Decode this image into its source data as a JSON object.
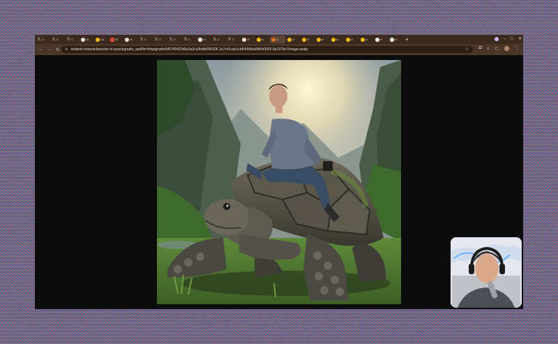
{
  "browser": {
    "tabs": [
      {
        "icon": "x-logo-icon",
        "label": "X"
      },
      {
        "icon": "x-logo-icon",
        "label": "X"
      },
      {
        "icon": "x-logo-icon",
        "label": "X"
      },
      {
        "icon": "github-icon",
        "label": "Gi"
      },
      {
        "icon": "huggingface-icon",
        "label": "Ga"
      },
      {
        "icon": "document-icon",
        "label": "Mi"
      },
      {
        "icon": "github-icon",
        "label": "Gi"
      },
      {
        "icon": "x-logo-icon",
        "label": "X"
      },
      {
        "icon": "x-logo-icon",
        "label": "X"
      },
      {
        "icon": "x-logo-icon",
        "label": "X"
      },
      {
        "icon": "x-logo-icon",
        "label": "X"
      },
      {
        "icon": "google-icon",
        "label": "Gr"
      },
      {
        "icon": "x-logo-icon",
        "label": "X"
      },
      {
        "icon": "x-logo-icon",
        "label": "X"
      },
      {
        "icon": "github-icon",
        "label": "Gi"
      },
      {
        "icon": "huggingface-icon",
        "label": "In"
      },
      {
        "icon": "flower-icon",
        "label": "In"
      },
      {
        "icon": "huggingface-icon",
        "label": "In"
      },
      {
        "icon": "huggingface-icon",
        "label": "In"
      },
      {
        "icon": "huggingface-icon",
        "label": "In"
      },
      {
        "icon": "huggingface-icon",
        "label": "In"
      },
      {
        "icon": "huggingface-icon",
        "label": "In"
      },
      {
        "icon": "huggingface-icon",
        "label": "In"
      },
      {
        "icon": "globe-icon",
        "label": "In"
      },
      {
        "icon": "google-icon",
        "label": "In"
      }
    ],
    "active_tab_index": 16,
    "new_tab_symbol": "+",
    "url": "instantx-instantcharacter.hf.space/gradio_api/file=/tmp/gradio/bf0740402d8a3a2ca3bdb0f00306 1e7c41cde1cb840b9da99fcb0555 8a1879e7/image.webp",
    "controls": {
      "minimize": "–",
      "maximize": "□",
      "close": "✕"
    }
  },
  "colors": {
    "tabstrip": "#3b2b1f",
    "toolbar": "#4a3526",
    "viewport": "#0c0c0c"
  }
}
